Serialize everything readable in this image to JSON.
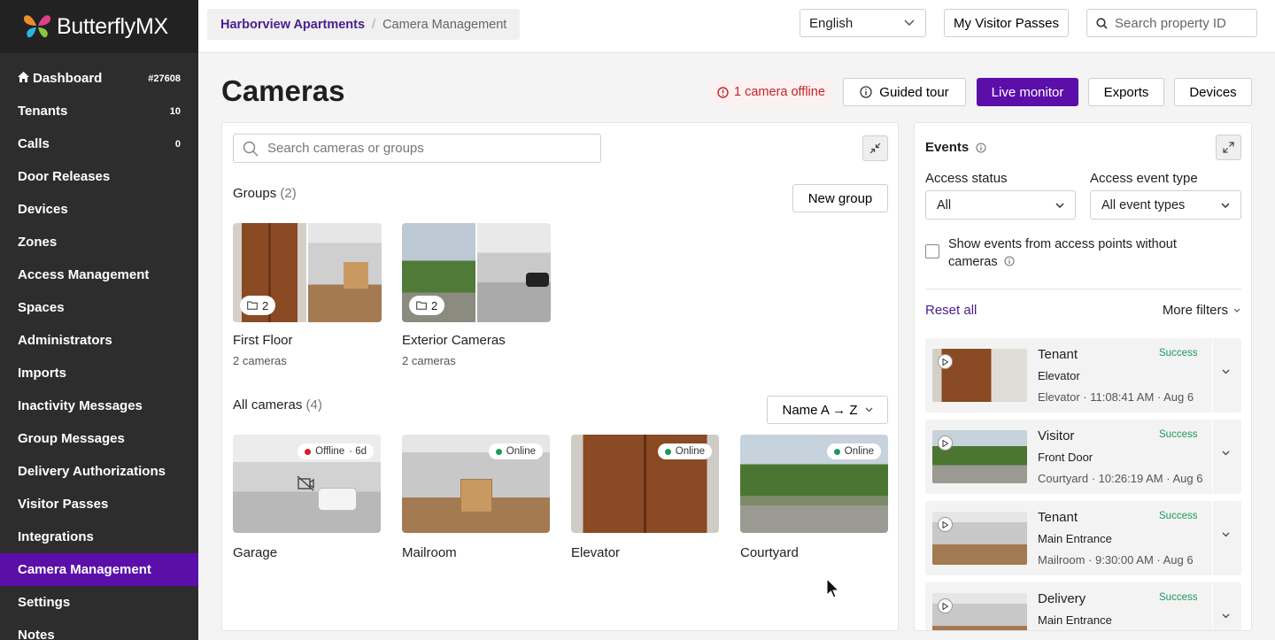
{
  "brand": {
    "name": "ButterflyMX"
  },
  "sidebar": {
    "items": [
      {
        "label": "Dashboard",
        "count": "#27608",
        "icon": "home-icon"
      },
      {
        "label": "Tenants",
        "count": "10"
      },
      {
        "label": "Calls",
        "count": "0"
      },
      {
        "label": "Door Releases",
        "count": ""
      },
      {
        "label": "Devices",
        "count": ""
      },
      {
        "label": "Zones",
        "count": ""
      },
      {
        "label": "Access Management",
        "count": ""
      },
      {
        "label": "Spaces",
        "count": ""
      },
      {
        "label": "Administrators",
        "count": ""
      },
      {
        "label": "Imports",
        "count": ""
      },
      {
        "label": "Inactivity Messages",
        "count": ""
      },
      {
        "label": "Group Messages",
        "count": ""
      },
      {
        "label": "Delivery Authorizations",
        "count": ""
      },
      {
        "label": "Visitor Passes",
        "count": ""
      },
      {
        "label": "Integrations",
        "count": ""
      },
      {
        "label": "Camera Management",
        "count": "",
        "active": true
      },
      {
        "label": "Settings",
        "count": ""
      },
      {
        "label": "Notes",
        "count": ""
      }
    ]
  },
  "topbar": {
    "breadcrumb": {
      "property": "Harborview Apartments",
      "separator": "/",
      "current": "Camera Management"
    },
    "language": "English",
    "visitor_passes": "My Visitor Passes",
    "search_placeholder": "Search property ID"
  },
  "header": {
    "title": "Cameras",
    "offline_alert": "1 camera offline",
    "guided_tour": "Guided tour",
    "live_monitor": "Live monitor",
    "exports": "Exports",
    "devices": "Devices"
  },
  "cameras_panel": {
    "search_placeholder": "Search cameras or groups",
    "groups_label": "Groups",
    "groups_count": "(2)",
    "new_group": "New group",
    "groups": [
      {
        "name": "First Floor",
        "sub": "2 cameras",
        "count": "2"
      },
      {
        "name": "Exterior Cameras",
        "sub": "2 cameras",
        "count": "2"
      }
    ],
    "all_label": "All cameras",
    "all_count": "(4)",
    "sort": "Name A → Z",
    "cameras": [
      {
        "name": "Garage",
        "status": "Offline",
        "since": "· 6d",
        "status_color": "#d0212b"
      },
      {
        "name": "Mailroom",
        "status": "Online",
        "status_color": "#1a9a5c"
      },
      {
        "name": "Elevator",
        "status": "Online",
        "status_color": "#1a9a5c"
      },
      {
        "name": "Courtyard",
        "status": "Online",
        "status_color": "#1a9a5c"
      }
    ]
  },
  "events": {
    "title": "Events",
    "access_status_label": "Access status",
    "access_status_value": "All",
    "event_type_label": "Access event type",
    "event_type_value": "All event types",
    "show_events_label": "Show events from access points without cameras",
    "reset": "Reset all",
    "more_filters": "More filters",
    "items": [
      {
        "role": "Tenant",
        "door": "Elevator",
        "meta": "Elevator · 11:08:41 AM · Aug 6",
        "status": "Success"
      },
      {
        "role": "Visitor",
        "door": "Front Door",
        "meta": "Courtyard · 10:26:19 AM · Aug 6",
        "status": "Success"
      },
      {
        "role": "Tenant",
        "door": "Main Entrance",
        "meta": "Mailroom · 9:30:00 AM · Aug 6",
        "status": "Success"
      },
      {
        "role": "Delivery",
        "door": "Main Entrance",
        "meta": "",
        "status": "Success"
      }
    ]
  },
  "colors": {
    "accent": "#5b0fa8",
    "sidebar": "#2d2d2d",
    "success": "#1a9a5c",
    "danger": "#c0262d"
  }
}
